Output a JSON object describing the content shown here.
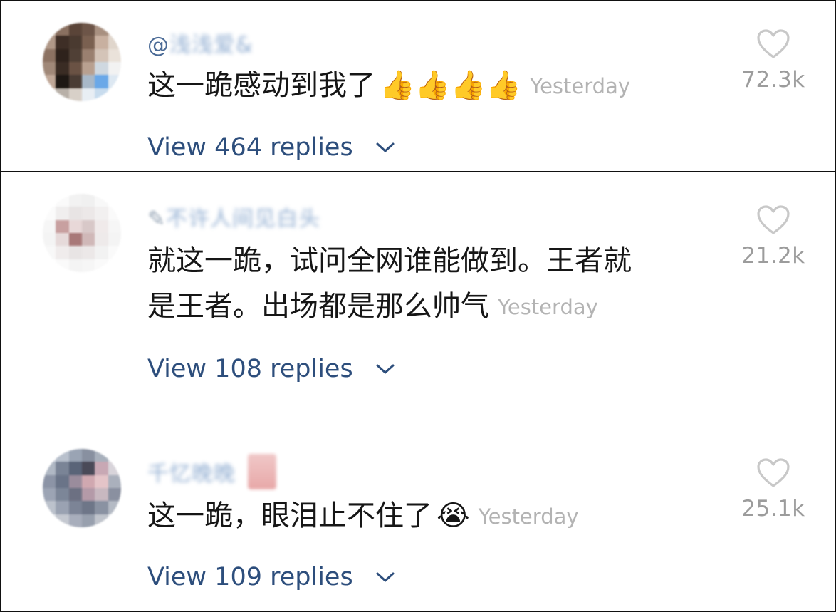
{
  "comments": [
    {
      "username_prefix": "@",
      "username_blurred": "浅浅爱&",
      "text": "这一跪感动到我了",
      "emoji": "👍👍👍👍",
      "timestamp": "Yesterday",
      "likes": "72.3k",
      "replies_label": "View 464 replies",
      "avatar_colors": [
        "#c9b8a8",
        "#8a7060",
        "#5a4438",
        "#6d5548",
        "#a89080",
        "#d8c8bc",
        "#b09888",
        "#3e2e26",
        "#4a3a30",
        "#7a6050",
        "#c8b0a0",
        "#e0d6cc",
        "#8c7262",
        "#2e221c",
        "#504036",
        "#9a8070",
        "#d4c4b8",
        "#eae2da",
        "#a08878",
        "#3a2c24",
        "#6a5244",
        "#b8a090",
        "#cfd8e0",
        "#f2f2f2",
        "#c0a898",
        "#1e1814",
        "#4a3c34",
        "#a8b8c8",
        "#6aa8e8",
        "#dde8f2",
        "#e8e0d8",
        "#b8b0a8",
        "#d8d0c8",
        "#e8eef4",
        "#c8dcee",
        "#f6f6f6"
      ]
    },
    {
      "username_prefix": "✎",
      "username_blurred": "不许人间见白头",
      "text_line1": "就这一跪，试问全网谁能做到。王者就",
      "text_line2": "是王者。出场都是那么帅气",
      "timestamp": "Yesterday",
      "likes": "21.2k",
      "replies_label": "View 108 replies",
      "avatar_colors": [
        "#ffffff",
        "#fafafa",
        "#f2f2f2",
        "#f0f0f0",
        "#f8f8f8",
        "#ffffff",
        "#fbfbfb",
        "#f0eeee",
        "#e8e4e4",
        "#ece8e8",
        "#f2f0f0",
        "#fafafa",
        "#f6f6f6",
        "#c8a0a0",
        "#e8d8d8",
        "#d8c8c8",
        "#f0eaea",
        "#f6f6f6",
        "#f4f4f4",
        "#e6dada",
        "#a87878",
        "#d0b8b8",
        "#eeeaea",
        "#f4f4f4",
        "#f8f8f8",
        "#f0ecec",
        "#e8e4e4",
        "#ece8e8",
        "#f2f2f2",
        "#fafafa",
        "#ffffff",
        "#fafafa",
        "#f4f4f4",
        "#f6f6f6",
        "#fafafa",
        "#ffffff"
      ]
    },
    {
      "username_prefix": "",
      "username_blurred": "千忆晚晚",
      "text": "这一跪，眼泪止不住了",
      "emoji": "😭",
      "timestamp": "Yesterday",
      "likes": "25.1k",
      "replies_label": "View 109 replies",
      "avatar_colors": [
        "#d8dce4",
        "#b8c0cc",
        "#9aa4b4",
        "#8890a0",
        "#a8b0bc",
        "#e4e6ea",
        "#b0b8c4",
        "#7a8496",
        "#5a6478",
        "#4a4a58",
        "#c8a8b4",
        "#d8d4da",
        "#8c94a6",
        "#6a7488",
        "#9a8c9c",
        "#d0a8b0",
        "#e4c4c8",
        "#aab0bc",
        "#9ca4b4",
        "#7c8698",
        "#6c7082",
        "#b49aa8",
        "#c8b8c0",
        "#8a90a0",
        "#bcc2cc",
        "#9aa2b2",
        "#7c8496",
        "#6e7688",
        "#8a92a2",
        "#b4bac4",
        "#e4e6ea",
        "#c4c8d0",
        "#a8aebc",
        "#98a0ae",
        "#c0c4cc",
        "#eceef0"
      ]
    }
  ],
  "colors": {
    "link": "#2d4e7c",
    "username": "#4a6a96",
    "timestamp": "#b3b3b3",
    "like_count": "#9c9c9c",
    "heart_stroke": "#c8c8c8",
    "panel_border": "#111111"
  },
  "icons": {
    "heart": "heart-outline-icon",
    "chevron": "chevron-down-icon"
  }
}
